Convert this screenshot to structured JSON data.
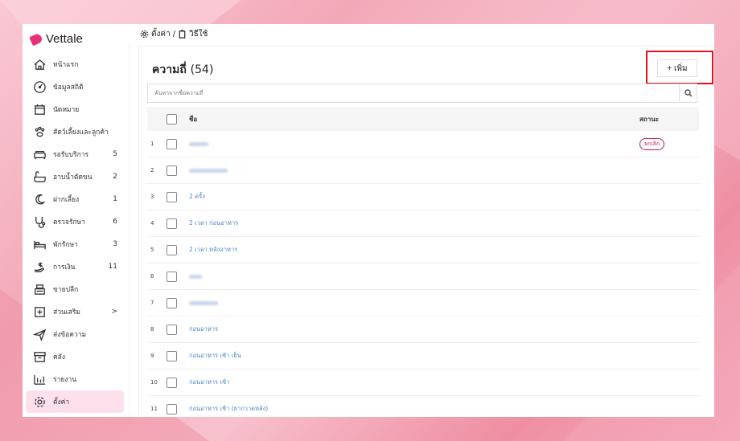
{
  "app": {
    "name": "Vettale"
  },
  "breadcrumb": {
    "settings": "ตั้งค่า",
    "sep": "/",
    "current": "วิธีใช้"
  },
  "nav": [
    {
      "label": "หน้าแรก",
      "count": "",
      "icon": "home-icon"
    },
    {
      "label": "ข้อมูลสถิติ",
      "count": "",
      "icon": "dashboard-icon"
    },
    {
      "label": "นัดหมาย",
      "count": "",
      "icon": "calendar-icon"
    },
    {
      "label": "สัตว์เลี้ยงและลูกค้า",
      "count": "",
      "icon": "paw-icon"
    },
    {
      "label": "รอรับบริการ",
      "count": "5",
      "icon": "sofa-icon"
    },
    {
      "label": "อาบน้ำตัดขน",
      "count": "2",
      "icon": "bathtub-icon"
    },
    {
      "label": "ฝากเลี้ยง",
      "count": "1",
      "icon": "moon-icon"
    },
    {
      "label": "ตรวจรักษา",
      "count": "6",
      "icon": "stethoscope-icon"
    },
    {
      "label": "พักรักษา",
      "count": "3",
      "icon": "bed-icon"
    },
    {
      "label": "การเงิน",
      "count": "11",
      "icon": "money-icon"
    },
    {
      "label": "ขายปลีก",
      "count": "",
      "icon": "cash-register-icon"
    },
    {
      "label": "ส่วนเสริม",
      "count": ">",
      "icon": "plus-box-icon"
    },
    {
      "label": "ส่งข้อความ",
      "count": "",
      "icon": "send-icon"
    },
    {
      "label": "คลัง",
      "count": "",
      "icon": "archive-icon"
    },
    {
      "label": "รายงาน",
      "count": "",
      "icon": "chart-icon"
    },
    {
      "label": "ตั้งค่า",
      "count": "",
      "icon": "gear-icon"
    }
  ],
  "main": {
    "title": "ความถี่",
    "count": "(54)",
    "add_label": "+ เพิ่ม",
    "search_placeholder": "ค้นหาจากชื่อความถี่",
    "columns": {
      "name": "ชื่อ",
      "status": "สถานะ"
    },
    "rows": [
      {
        "num": "1",
        "name": "",
        "status": "ยกเลิก"
      },
      {
        "num": "2",
        "name": "",
        "status": ""
      },
      {
        "num": "3",
        "name": "2 ครั้ง",
        "status": ""
      },
      {
        "num": "4",
        "name": "2 เวลา ก่อนอาหาร",
        "status": ""
      },
      {
        "num": "5",
        "name": "2 เวลา หลังอาหาร",
        "status": ""
      },
      {
        "num": "6",
        "name": "",
        "status": ""
      },
      {
        "num": "7",
        "name": "",
        "status": ""
      },
      {
        "num": "8",
        "name": "ก่อนอาหาร",
        "status": ""
      },
      {
        "num": "9",
        "name": "ก่อนอาหาร เช้า เย็น",
        "status": ""
      },
      {
        "num": "10",
        "name": "ก่อนอาหาร เช้า",
        "status": ""
      },
      {
        "num": "11",
        "name": "ก่อนอาหาร เช้า (ยากวาดหลัง)",
        "status": ""
      }
    ]
  }
}
